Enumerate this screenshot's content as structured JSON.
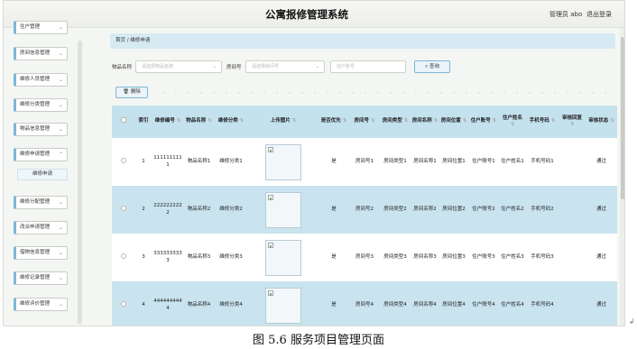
{
  "header": {
    "title": "公寓报修管理系统",
    "user": "管理员 abo",
    "logout": "退出登录"
  },
  "sidebar": {
    "items": [
      "住户管理",
      "房间信息管理",
      "维修人员管理",
      "维修分类管理",
      "物品信息管理",
      "维修申请管理",
      "维修分配管理",
      "改派申请管理",
      "借物信息管理",
      "维修记录管理",
      "维修评价管理"
    ],
    "sub_item": "维修申请"
  },
  "breadcrumb": "首页 / 维修申请",
  "search": {
    "item_label": "物品名称",
    "item_placeholder": "请选择物品名称",
    "room_label": "房间号",
    "room_placeholder": "请选择房间号",
    "account_placeholder": "住户账号",
    "query_button": "查询"
  },
  "toolbar": {
    "delete_button": "删除"
  },
  "table": {
    "headers": [
      "索引",
      "维修编号",
      "物品名称",
      "维修分类",
      "上传图片",
      "是否优先",
      "房间号",
      "房间类型",
      "房间名称",
      "房间位置",
      "住户账号",
      "住户姓名",
      "手机号码",
      "审核回复",
      "审核状态"
    ],
    "rows": [
      {
        "index": "1",
        "repair_no": "1111111111",
        "item": "物品名称1",
        "category": "维修分类1",
        "priority": "是",
        "room_no": "房间号1",
        "room_type": "房间类型1",
        "room_name": "房间名称1",
        "room_loc": "房间位置1",
        "account": "住户账号1",
        "name": "住户姓名1",
        "phone": "手机号码1",
        "reply": "",
        "status": "通过"
      },
      {
        "index": "2",
        "repair_no": "2222222222",
        "item": "物品名称2",
        "category": "维修分类2",
        "priority": "是",
        "room_no": "房间号2",
        "room_type": "房间类型2",
        "room_name": "房间名称2",
        "room_loc": "房间位置2",
        "account": "住户账号2",
        "name": "住户姓名2",
        "phone": "手机号码2",
        "reply": "",
        "status": "通过"
      },
      {
        "index": "3",
        "repair_no": "3333333333",
        "item": "物品名称3",
        "category": "维修分类3",
        "priority": "是",
        "room_no": "房间号3",
        "room_type": "房间类型3",
        "room_name": "房间名称3",
        "room_loc": "房间位置3",
        "account": "住户账号3",
        "name": "住户姓名3",
        "phone": "手机号码3",
        "reply": "",
        "status": "通过"
      },
      {
        "index": "4",
        "repair_no": "4444444444",
        "item": "物品名称4",
        "category": "维修分类4",
        "priority": "是",
        "room_no": "房间号4",
        "room_type": "房间类型4",
        "room_name": "房间名称4",
        "room_loc": "房间位置4",
        "account": "住户账号4",
        "name": "住户姓名4",
        "phone": "手机号码4",
        "reply": "",
        "status": "通过"
      }
    ]
  },
  "caption": "图 5.6 服务项目管理页面"
}
